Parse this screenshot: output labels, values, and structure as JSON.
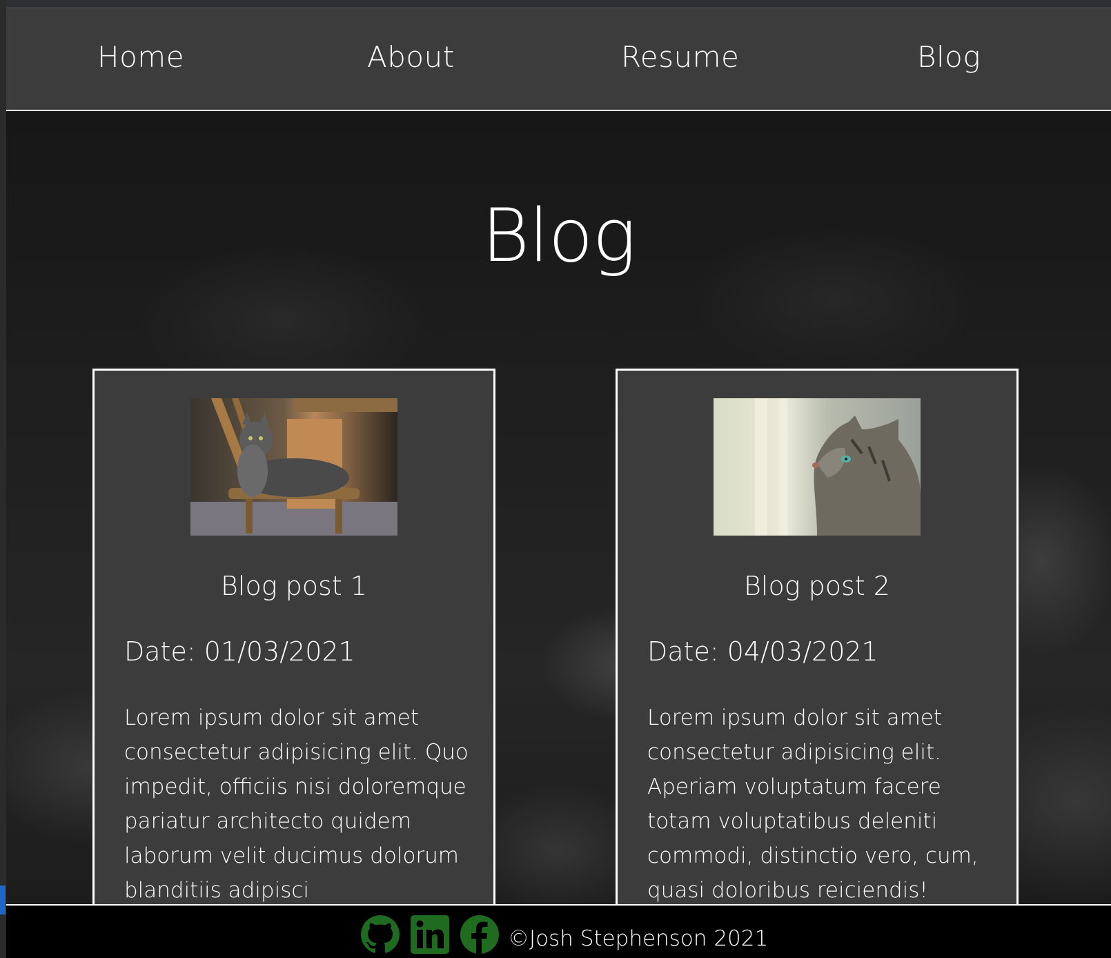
{
  "nav": {
    "items": [
      {
        "label": "Home"
      },
      {
        "label": "About"
      },
      {
        "label": "Resume"
      },
      {
        "label": "Blog"
      }
    ]
  },
  "main": {
    "title": "Blog",
    "posts": [
      {
        "title": "Blog post 1",
        "date": "Date: 01/03/2021",
        "image": "cat-on-chair-photo",
        "body": "Lorem ipsum dolor sit amet consectetur adipisicing elit. Quo impedit, officiis nisi doloremque pariatur architecto quidem laborum velit ducimus dolorum blanditiis adipisci"
      },
      {
        "title": "Blog post 2",
        "date": "Date: 04/03/2021",
        "image": "cat-looking-up-photo",
        "body": "Lorem ipsum dolor sit amet consectetur adipisicing elit. Aperiam voluptatum facere totam voluptatibus deleniti commodi, distinctio vero, cum, quasi doloribus reiciendis!"
      }
    ]
  },
  "footer": {
    "icons": [
      "github-icon",
      "linkedin-icon",
      "facebook-icon"
    ],
    "icon_color": "#1f6b1f",
    "copyright": "©Josh Stephenson 2021"
  },
  "colors": {
    "nav_bg": "#3e3e3e",
    "card_bg": "#3c3c3c",
    "footer_bg": "#000000",
    "text": "#ffffff"
  }
}
